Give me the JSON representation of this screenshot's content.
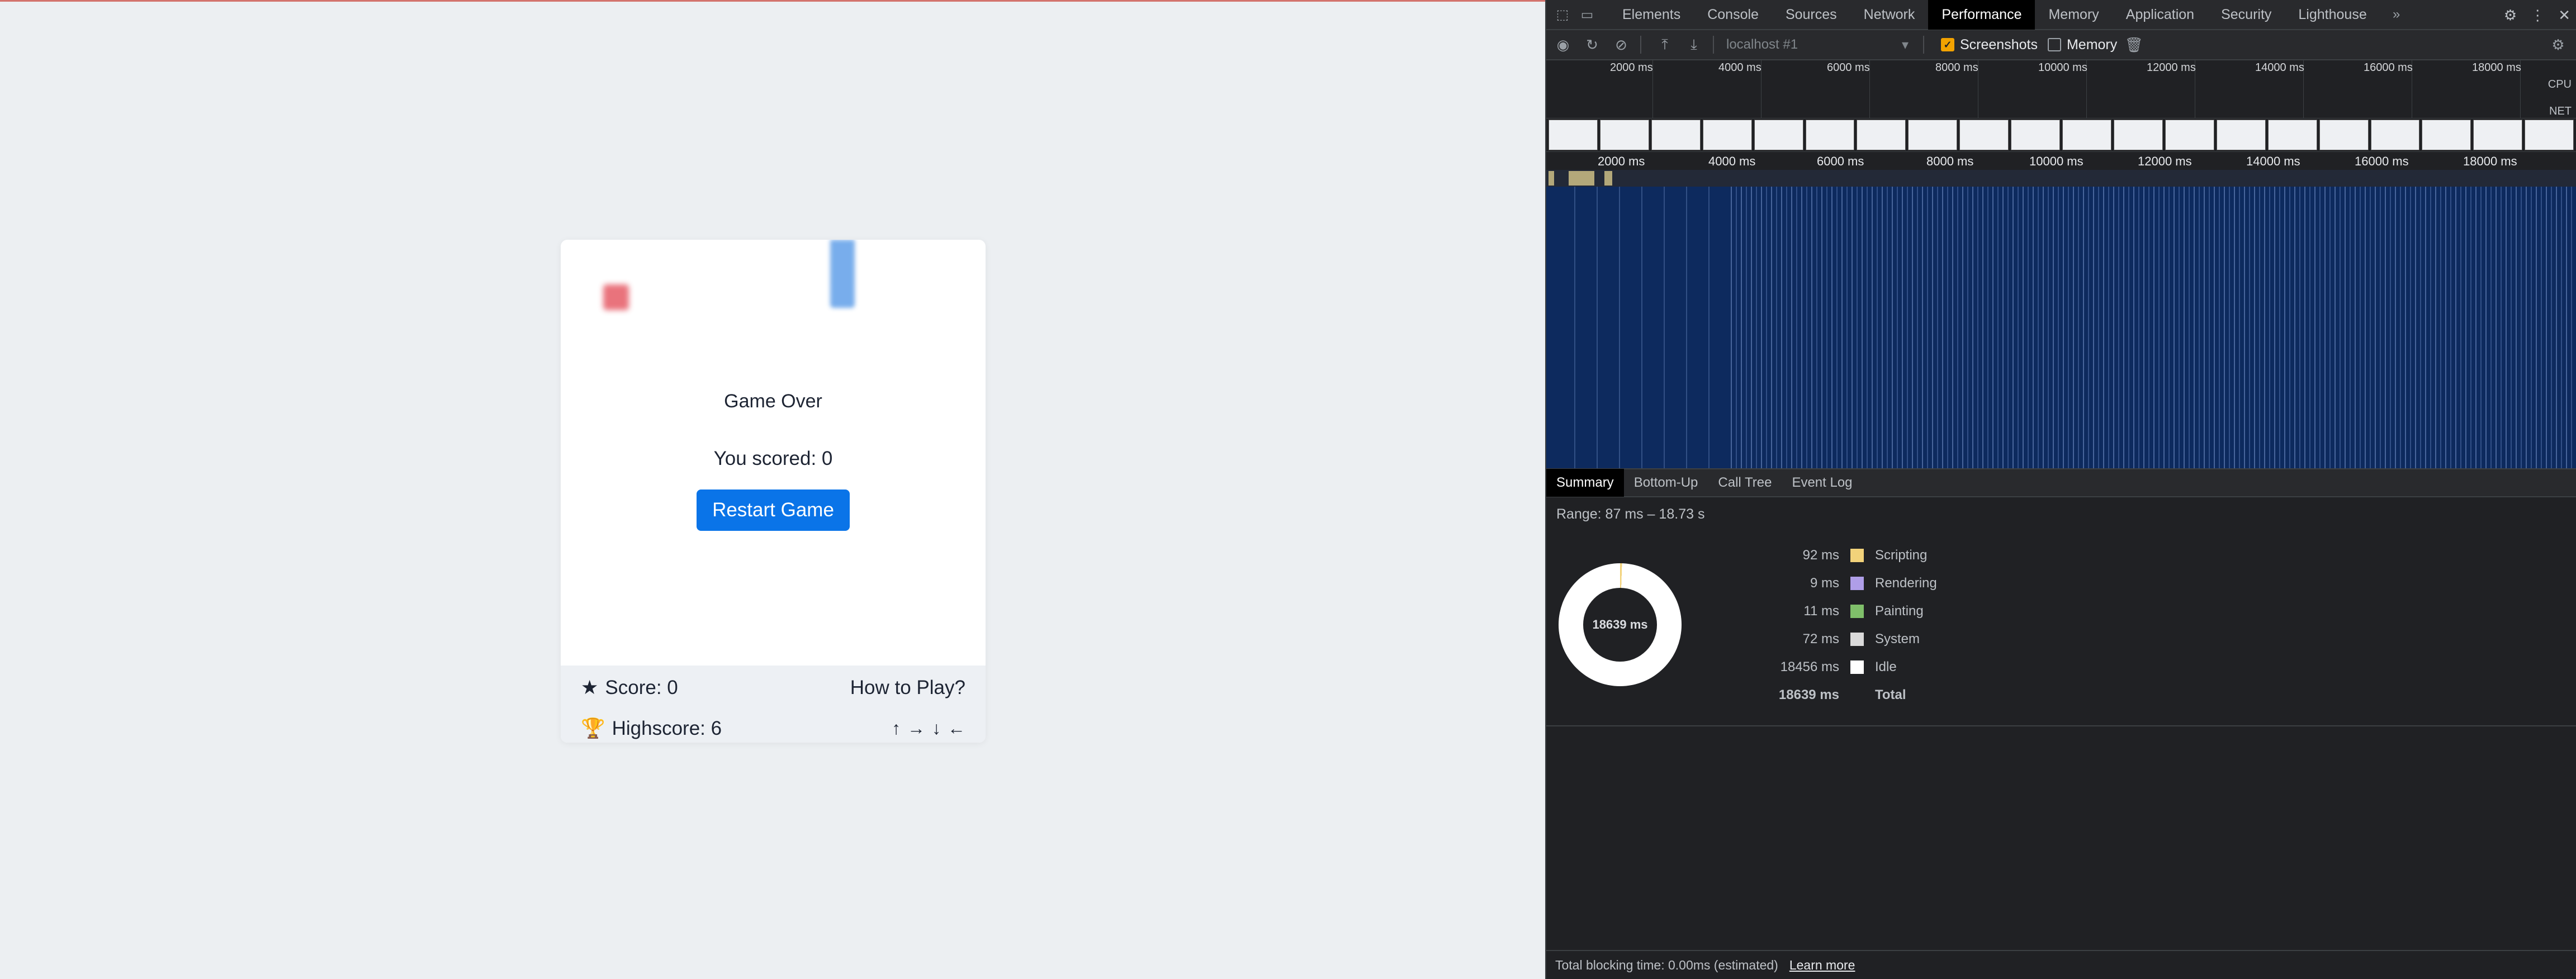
{
  "game": {
    "title": "Game Over",
    "scored": "You scored: 0",
    "restart_label": "Restart Game",
    "score": "Score: 0",
    "highscore": "Highscore: 6",
    "how_to_play": "How to Play?",
    "arrows": [
      "↑",
      "→",
      "↓",
      "←"
    ],
    "colors": {
      "player": "#e65b66",
      "obstacle": "#6aa5ea",
      "button": "#0a74e8"
    }
  },
  "devtools": {
    "tabs": [
      "Elements",
      "Console",
      "Sources",
      "Network",
      "Performance",
      "Memory",
      "Application",
      "Security",
      "Lighthouse"
    ],
    "active_tab": "Performance",
    "more_tabs_icon": "»",
    "toolbar": {
      "target": "localhost #1",
      "screenshots_label": "Screenshots",
      "screenshots_checked": true,
      "memory_label": "Memory",
      "memory_checked": false
    },
    "overview_ticks": [
      "2000 ms",
      "4000 ms",
      "6000 ms",
      "8000 ms",
      "10000 ms",
      "12000 ms",
      "14000 ms",
      "16000 ms",
      "18000 ms"
    ],
    "cpu_label": "CPU",
    "net_label": "NET",
    "timeline_ticks": [
      "2000 ms",
      "4000 ms",
      "6000 ms",
      "8000 ms",
      "10000 ms",
      "12000 ms",
      "14000 ms",
      "16000 ms",
      "18000 ms"
    ],
    "bottom_tabs": [
      "Summary",
      "Bottom-Up",
      "Call Tree",
      "Event Log"
    ],
    "active_bottom_tab": "Summary",
    "summary": {
      "range": "Range: 87 ms – 18.73 s",
      "donut_center": "18639 ms",
      "rows": [
        {
          "value": "92 ms",
          "name": "Scripting",
          "color": "#f2d27a"
        },
        {
          "value": "9 ms",
          "name": "Rendering",
          "color": "#af9ee8"
        },
        {
          "value": "11 ms",
          "name": "Painting",
          "color": "#7fbf6a"
        },
        {
          "value": "72 ms",
          "name": "System",
          "color": "#dadada"
        },
        {
          "value": "18456 ms",
          "name": "Idle",
          "color": "#ffffff"
        }
      ],
      "total_value": "18639 ms",
      "total_label": "Total"
    },
    "status": {
      "text": "Total blocking time: 0.00ms (estimated)",
      "link": "Learn more"
    }
  }
}
